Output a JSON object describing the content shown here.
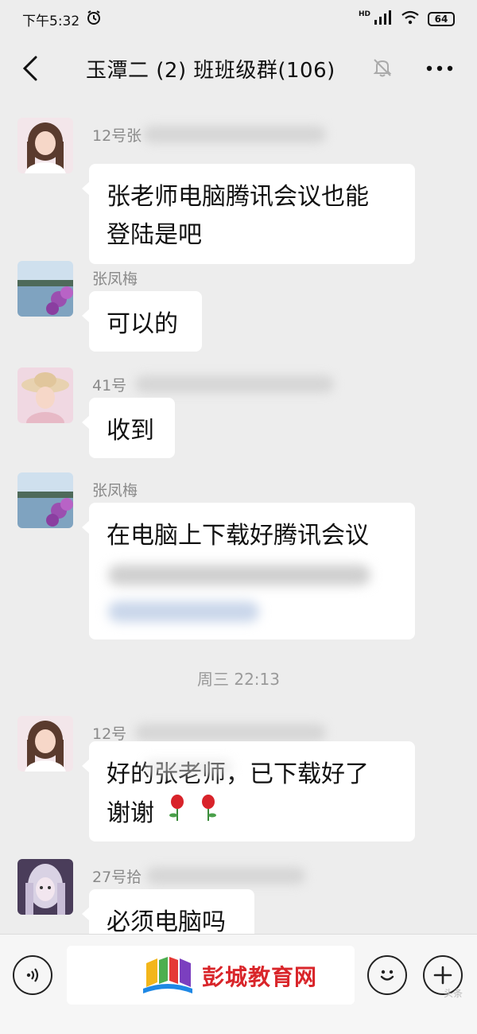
{
  "status_bar": {
    "time": "下午5:32",
    "network_badge": "HD",
    "battery": "64"
  },
  "header": {
    "title": "玉潭二 (2) 班班级群(106)"
  },
  "messages": [
    {
      "sender": "12号张",
      "lines": [
        "张老师电脑腾讯会议也能",
        "登陆是吧"
      ]
    },
    {
      "sender": "张凤梅",
      "lines": [
        "可以的"
      ]
    },
    {
      "sender": "41号",
      "lines": [
        "收到"
      ]
    },
    {
      "sender": "张凤梅",
      "lines": [
        "在电脑上下载好腾讯会议"
      ]
    },
    {
      "sender": "12号",
      "lines": [
        "好的张老师，已下载好了",
        "谢谢"
      ]
    },
    {
      "sender": "27号拾",
      "lines": [
        "必须电脑吗"
      ]
    }
  ],
  "timestamp": "周三 22:13",
  "input_bar": {
    "logo_text": "彭城教育网"
  },
  "watermark": "头条",
  "colors": {
    "background": "#ededed",
    "bubble": "#ffffff",
    "logo_red": "#d9252a"
  }
}
